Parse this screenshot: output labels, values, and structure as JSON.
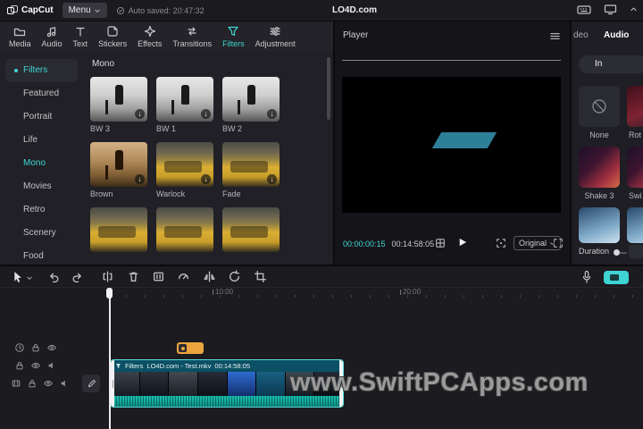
{
  "colors": {
    "accent": "#41d6d2",
    "clip_border": "#56dcd6",
    "record_button": "#3fd3d3",
    "sticker_clip": "#eaa43e",
    "watermark_gray": "#a0a0a0",
    "timecode_current": "#41d6d2"
  },
  "topbar": {
    "logo_text": "CapCut",
    "menu_label": "Menu",
    "autosave": "Auto saved: 20:47:32",
    "title": "LO4D.com"
  },
  "tabbar": {
    "tabs": [
      {
        "label": "Media"
      },
      {
        "label": "Audio"
      },
      {
        "label": "Text"
      },
      {
        "label": "Stickers"
      },
      {
        "label": "Effects"
      },
      {
        "label": "Transitions"
      },
      {
        "label": "Filters"
      },
      {
        "label": "Adjustment"
      }
    ]
  },
  "sidebar": {
    "items": [
      {
        "label": "Filters"
      },
      {
        "label": "Featured"
      },
      {
        "label": "Portrait"
      },
      {
        "label": "Life"
      },
      {
        "label": "Mono"
      },
      {
        "label": "Movies"
      },
      {
        "label": "Retro"
      },
      {
        "label": "Scenery"
      },
      {
        "label": "Food"
      }
    ]
  },
  "filters_panel": {
    "section_title": "Mono",
    "filters": [
      {
        "name": "BW 3"
      },
      {
        "name": "BW 1"
      },
      {
        "name": "BW 2"
      },
      {
        "name": "Brown"
      },
      {
        "name": "Warlock"
      },
      {
        "name": "Fade"
      }
    ]
  },
  "player": {
    "title": "Player",
    "current_time": "00:00:00:15",
    "total_time": "00:14:58:05",
    "quality_label": "Original"
  },
  "right_panel": {
    "tab_video_partial": "deo",
    "tab_audio": "Audio",
    "segment_in": "In",
    "tiles": [
      {
        "label": "None"
      },
      {
        "label": "Rot"
      },
      {
        "label": "Shake 3"
      },
      {
        "label": "Swi"
      }
    ],
    "duration_label": "Duration"
  },
  "timeline": {
    "ruler_labels": [
      {
        "text": "10:00"
      },
      {
        "text": "20:00"
      }
    ],
    "clip": {
      "badge": "Filters",
      "filename": "LO4D.com - Test.mkv",
      "duration": "00:14:58:05"
    }
  },
  "watermark": {
    "text": "www.SwiftPCApps.com"
  },
  "icons": {
    "download": "circle-down-arrow",
    "play": "triangle",
    "menu-hamburger": "three-lines",
    "filters-funnel": "funnel",
    "none": "circle-slash",
    "chevron-down": "v"
  }
}
